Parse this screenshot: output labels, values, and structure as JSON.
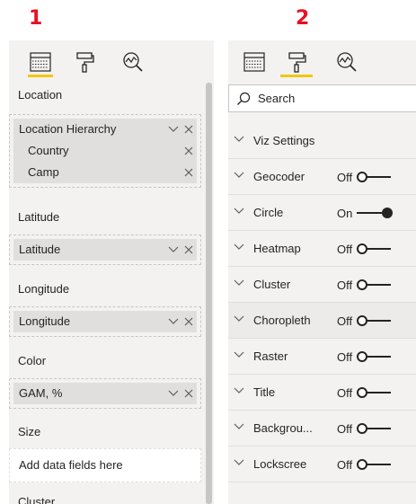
{
  "markers": [
    "1",
    "2"
  ],
  "colors": {
    "accent": "#f2c811",
    "marker": "#e81123",
    "pane_bg": "#f3f2f1",
    "pill_bg": "#e1dfdd"
  },
  "left_pane": {
    "tabs": [
      {
        "icon": "fields-icon",
        "active": true
      },
      {
        "icon": "format-paint-roller-icon",
        "active": false
      },
      {
        "icon": "analytics-magnifier-icon",
        "active": false
      }
    ],
    "location_label": "Location",
    "location_hierarchy": "Location Hierarchy",
    "location_children": [
      "Country",
      "Camp"
    ],
    "latitude_label": "Latitude",
    "latitude_value": "Latitude",
    "longitude_label": "Longitude",
    "longitude_value": "Longitude",
    "color_label": "Color",
    "color_value": "GAM, %",
    "size_label": "Size",
    "size_placeholder": "Add data fields here",
    "cluster_label": "Cluster"
  },
  "right_pane": {
    "tabs": [
      {
        "icon": "fields-icon",
        "active": false
      },
      {
        "icon": "format-paint-roller-icon",
        "active": true
      },
      {
        "icon": "analytics-magnifier-icon",
        "active": false
      }
    ],
    "search_placeholder": "Search",
    "sections": [
      {
        "label": "Viz Settings",
        "toggle": null
      },
      {
        "label": "Geocoder",
        "toggle": "Off"
      },
      {
        "label": "Circle",
        "toggle": "On"
      },
      {
        "label": "Heatmap",
        "toggle": "Off"
      },
      {
        "label": "Cluster",
        "toggle": "Off"
      },
      {
        "label": "Choropleth",
        "toggle": "Off"
      },
      {
        "label": "Raster",
        "toggle": "Off"
      },
      {
        "label": "Title",
        "toggle": "Off"
      },
      {
        "label": "Backgrou...",
        "toggle": "Off"
      },
      {
        "label": "Lockscree",
        "toggle": "Off"
      }
    ]
  }
}
